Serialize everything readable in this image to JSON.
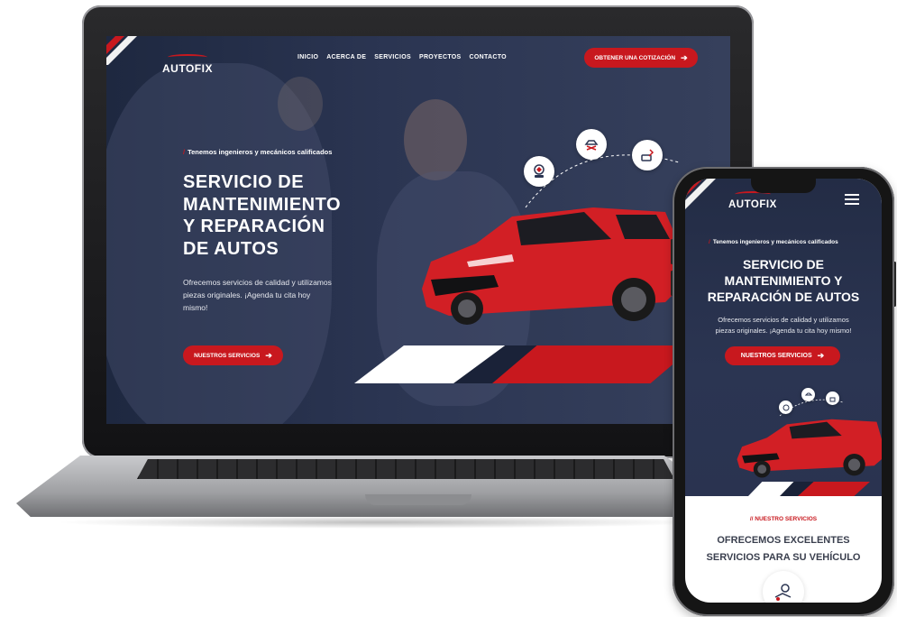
{
  "colors": {
    "brand_red": "#c8181e",
    "navy": "#232c45",
    "white": "#ffffff"
  },
  "site": {
    "logo": "AUTOFIX",
    "nav": [
      "INICIO",
      "ACERCA DE",
      "SERVICIOS",
      "PROYECTOS",
      "CONTACTO"
    ],
    "cta_quote": "OBTENER UNA COTIZACIÓN",
    "eyebrow": "Tenemos ingenieros y mecánicos calificados",
    "hero_title_lines": [
      "SERVICIO DE",
      "MANTENIMIENTO",
      "Y REPARACIÓN",
      "DE AUTOS"
    ],
    "hero_subtitle_lines": [
      "Ofrecemos servicios de calidad y utilizamos",
      "piezas originales. ¡Agenda tu cita hoy",
      "mismo!"
    ],
    "cta_services": "NUESTROS SERVICIOS"
  },
  "mobile": {
    "logo": "AUTOFIX",
    "eyebrow": "Tenemos ingenieros y mecánicos calificados",
    "hero_title_lines": [
      "SERVICIO DE",
      "MANTENIMIENTO Y",
      "REPARACIÓN DE AUTOS"
    ],
    "hero_subtitle_lines": [
      "Ofrecemos servicios de calidad y utilizamos",
      "piezas originales. ¡Agenda tu cita hoy mismo!"
    ],
    "cta_services": "NUESTROS SERVICIOS",
    "services_eyebrow": "NUESTRO SERVICIOS",
    "services_title_lines": [
      "OFRECEMOS EXCELENTES",
      "SERVICIOS PARA SU VEHÍCULO"
    ]
  },
  "icons": [
    "tire-icon",
    "car-lift-icon",
    "engine-wrench-icon",
    "mechanic-icon",
    "menu-icon",
    "arrow-right-icon"
  ]
}
